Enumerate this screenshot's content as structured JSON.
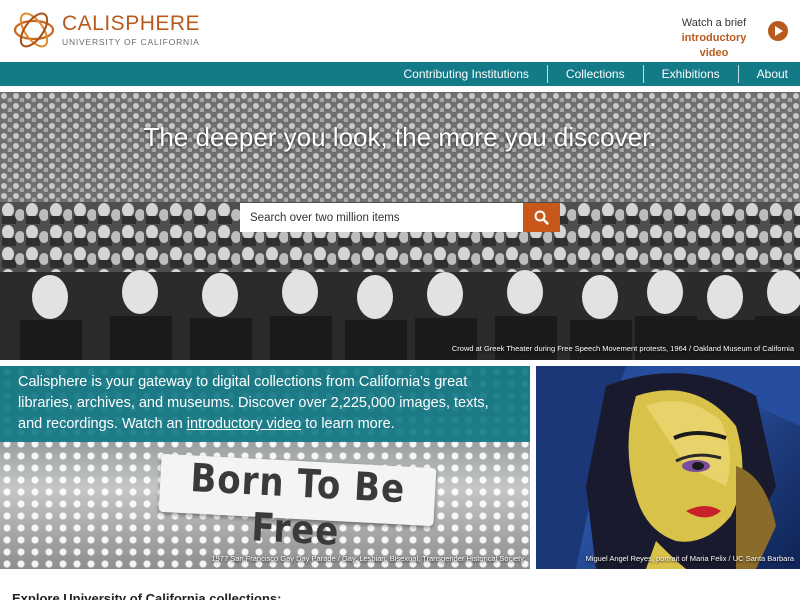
{
  "header": {
    "logo_name": "CALISPHERE",
    "logo_sub": "UNIVERSITY OF CALIFORNIA",
    "intro_line1": "Watch a brief",
    "intro_line2": "introductory",
    "intro_line3": "video",
    "play_icon": "play-icon"
  },
  "nav": {
    "items": [
      "Contributing Institutions",
      "Collections",
      "Exhibitions",
      "About"
    ]
  },
  "hero": {
    "title": "The deeper you look, the more you discover.",
    "search_placeholder": "Search over two million items",
    "search_icon": "search-icon",
    "caption": "Crowd at Greek Theater during Free Speech Movement protests, 1964 / Oakland Museum of California"
  },
  "intro": {
    "text_before": "Calisphere is your gateway to digital collections from California's great libraries, archives, and museums. Discover over 2,225,000 images, texts, and recordings. Watch an ",
    "link_text": "introductory video",
    "text_after": " to learn more."
  },
  "left_panel": {
    "banner_text": "Born To Be Free",
    "caption": "1977 San Francisco Gay Day Parade / Gay, Lesbian, Bisexual, Transgender Historical Society"
  },
  "right_panel": {
    "caption": "Miguel Angel Reyes, portrait of Maria Felix / UC Santa Barbara"
  },
  "explore_heading": "Explore University of California collections:",
  "colors": {
    "brand_orange": "#b85a1e",
    "teal": "#137a87",
    "search_button": "#c8571a"
  }
}
